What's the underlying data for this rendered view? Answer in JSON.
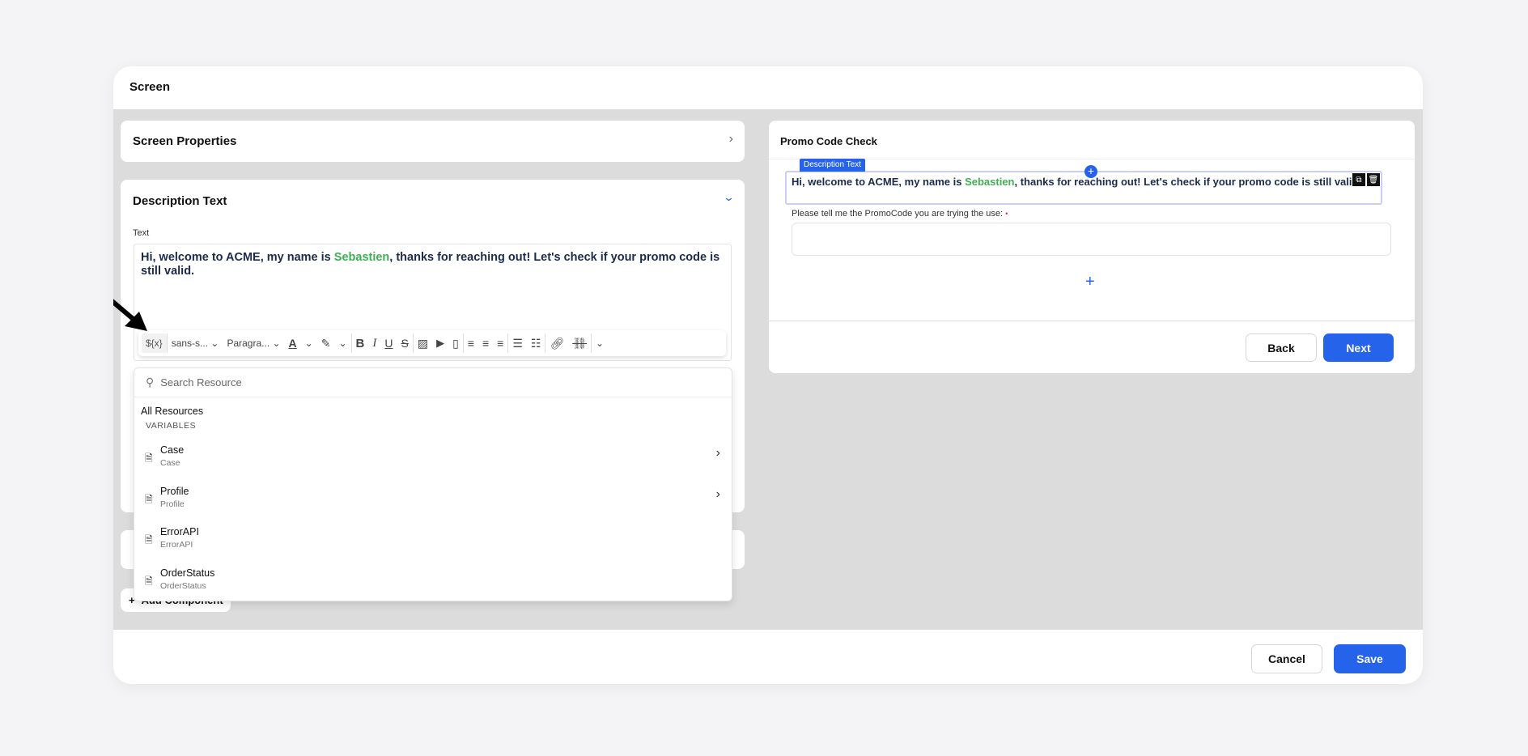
{
  "modal": {
    "title": "Screen",
    "cancel_label": "Cancel",
    "save_label": "Save"
  },
  "left": {
    "screen_properties": "Screen Properties",
    "description_section": "Description Text",
    "text_label": "Text",
    "editor_text": {
      "before": "Hi, welcome to ACME, my name is ",
      "variable": "Sebastien",
      "after": ", thanks for reaching out! Let's check if your promo code is still valid."
    },
    "toolbar": {
      "variable_button": "${x}",
      "font": "sans-s...",
      "block": "Paragra..."
    },
    "resource_dropdown": {
      "search_placeholder": "Search Resource",
      "heading": "All Resources",
      "group": "VARIABLES",
      "items": [
        {
          "title": "Case",
          "subtitle": "Case",
          "has_children": true
        },
        {
          "title": "Profile",
          "subtitle": "Profile",
          "has_children": true
        },
        {
          "title": "ErrorAPI",
          "subtitle": "ErrorAPI",
          "has_children": false
        },
        {
          "title": "OrderStatus",
          "subtitle": "OrderStatus",
          "has_children": false
        }
      ]
    },
    "add_component": "Add Component"
  },
  "preview": {
    "title": "Promo Code Check",
    "selected_tag": "Description Text",
    "field_label": "Please tell me the PromoCode you are trying the use:",
    "required_mark": "•",
    "back_label": "Back",
    "next_label": "Next"
  },
  "colors": {
    "accent": "#2563eb",
    "variable": "#3fae54",
    "text": "#1b2b4b"
  }
}
